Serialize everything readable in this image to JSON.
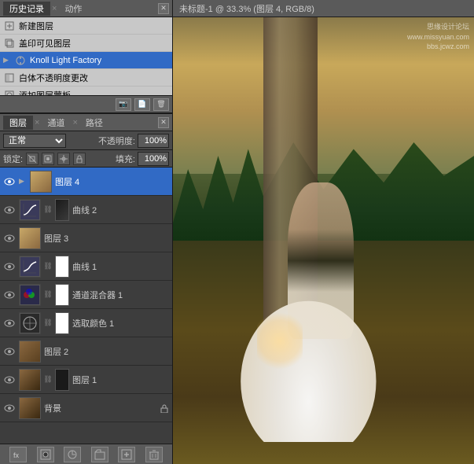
{
  "historyPanel": {
    "tabs": [
      "历史记录",
      "动作"
    ],
    "activeTab": "历史记录",
    "items": [
      {
        "id": 1,
        "label": "新建图层",
        "icon": "new-layer"
      },
      {
        "id": 2,
        "label": "盖印可见图层",
        "icon": "merge"
      },
      {
        "id": 3,
        "label": "Knoll Light Factory",
        "icon": "filter",
        "selected": true
      },
      {
        "id": 4,
        "label": "白体不透明度更改",
        "icon": "opacity"
      },
      {
        "id": 5,
        "label": "添加图层蒙板",
        "icon": "mask"
      }
    ]
  },
  "layersPanel": {
    "tabs": [
      "图层",
      "通道",
      "路径"
    ],
    "activeTab": "图层",
    "blendMode": "正常",
    "opacity": "100%",
    "fill": "100%",
    "lockOptions": [
      "锁定:",
      "透明",
      "图像",
      "位置",
      "全部"
    ],
    "layers": [
      {
        "id": 1,
        "name": "图层 4",
        "visible": true,
        "selected": true,
        "type": "image",
        "thumbColor": "#c8a868",
        "hasExpand": true
      },
      {
        "id": 2,
        "name": "曲线 2",
        "visible": true,
        "selected": false,
        "type": "adjustment-curves",
        "hasMask": true
      },
      {
        "id": 3,
        "name": "图层 3",
        "visible": true,
        "selected": false,
        "type": "image",
        "thumbColor": "#c8a868"
      },
      {
        "id": 4,
        "name": "曲线 1",
        "visible": true,
        "selected": false,
        "type": "adjustment-curves",
        "hasMask": true
      },
      {
        "id": 5,
        "name": "通道混合器 1",
        "visible": true,
        "selected": false,
        "type": "adjustment-channel",
        "hasMask": true
      },
      {
        "id": 6,
        "name": "选取颜色 1",
        "visible": true,
        "selected": false,
        "type": "adjustment-color",
        "hasMask": true
      },
      {
        "id": 7,
        "name": "图层 2",
        "visible": true,
        "selected": false,
        "type": "image",
        "thumbColor": "#8a6840"
      },
      {
        "id": 8,
        "name": "图层 1",
        "visible": true,
        "selected": false,
        "type": "image",
        "thumbColor": "#8a6840"
      },
      {
        "id": 9,
        "name": "背景",
        "visible": true,
        "selected": false,
        "type": "background",
        "thumbColor": "#8a6840",
        "locked": true
      }
    ],
    "footerButtons": [
      "fx",
      "mask",
      "adjustment",
      "group",
      "new",
      "delete"
    ]
  },
  "canvas": {
    "title": "未标题-1 @ 33.3% (图层 4, RGB/8)",
    "watermark": "思缘设计论坛\nwww.missyuan.com\nbbs.jcwz.com"
  }
}
